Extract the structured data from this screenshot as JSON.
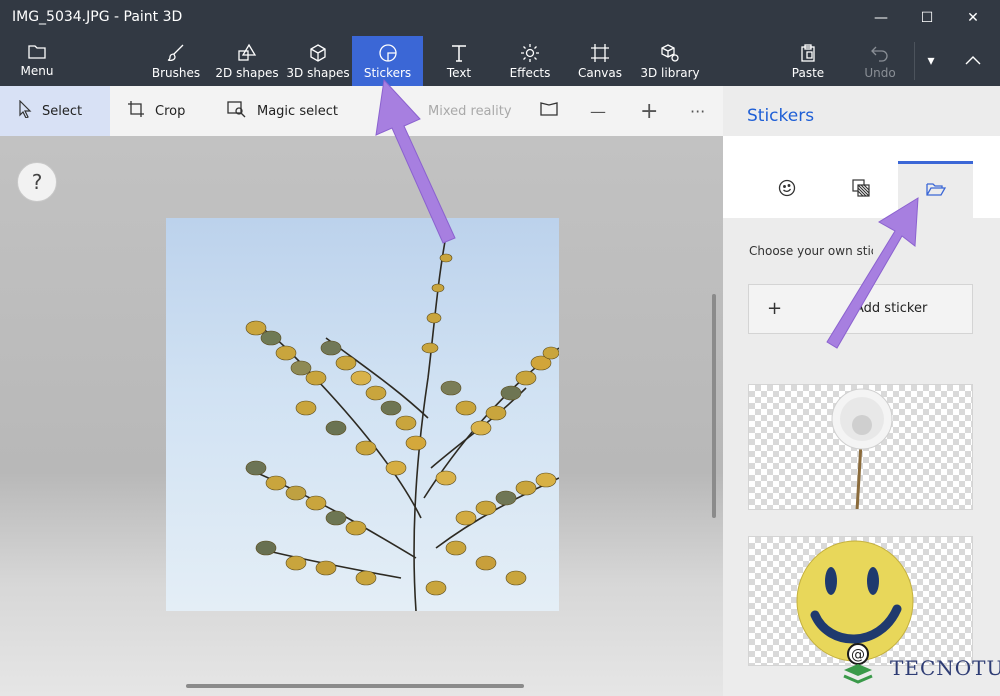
{
  "window": {
    "title": "IMG_5034.JPG - Paint 3D",
    "minimize_glyph": "—",
    "maximize_glyph": "☐",
    "close_glyph": "✕"
  },
  "ribbon": {
    "menu_label": "Menu",
    "tools": [
      {
        "label": "Brushes",
        "icon": "brush-icon"
      },
      {
        "label": "2D shapes",
        "icon": "2d-shapes-icon"
      },
      {
        "label": "3D shapes",
        "icon": "3d-shapes-icon"
      },
      {
        "label": "Stickers",
        "icon": "stickers-icon",
        "active": true
      },
      {
        "label": "Text",
        "icon": "text-icon"
      },
      {
        "label": "Effects",
        "icon": "effects-icon"
      },
      {
        "label": "Canvas",
        "icon": "canvas-icon"
      },
      {
        "label": "3D library",
        "icon": "3d-library-icon"
      }
    ],
    "paste_label": "Paste",
    "undo_label": "Undo",
    "more_glyph": "▾",
    "collapse_glyph": "︿"
  },
  "subbar": {
    "select_label": "Select",
    "crop_label": "Crop",
    "magic_select_label": "Magic select",
    "mixed_reality_label": "Mixed reality",
    "minus_glyph": "—",
    "plus_glyph": "+",
    "more_glyph": "···"
  },
  "canvas": {
    "help_glyph": "?"
  },
  "panel": {
    "title": "Stickers",
    "tabs": [
      {
        "icon": "sticker-face-icon"
      },
      {
        "icon": "texture-icon"
      },
      {
        "icon": "folder-open-icon",
        "active": true
      }
    ],
    "choose_text": "Choose your own sticker",
    "add_sticker_plus": "+",
    "add_sticker_label": "Add sticker"
  },
  "watermark": {
    "text": "TECNOTUTO"
  },
  "colors": {
    "accent": "#3b67d6",
    "ribbon": "#323943",
    "arrow": "#a77fe0"
  }
}
